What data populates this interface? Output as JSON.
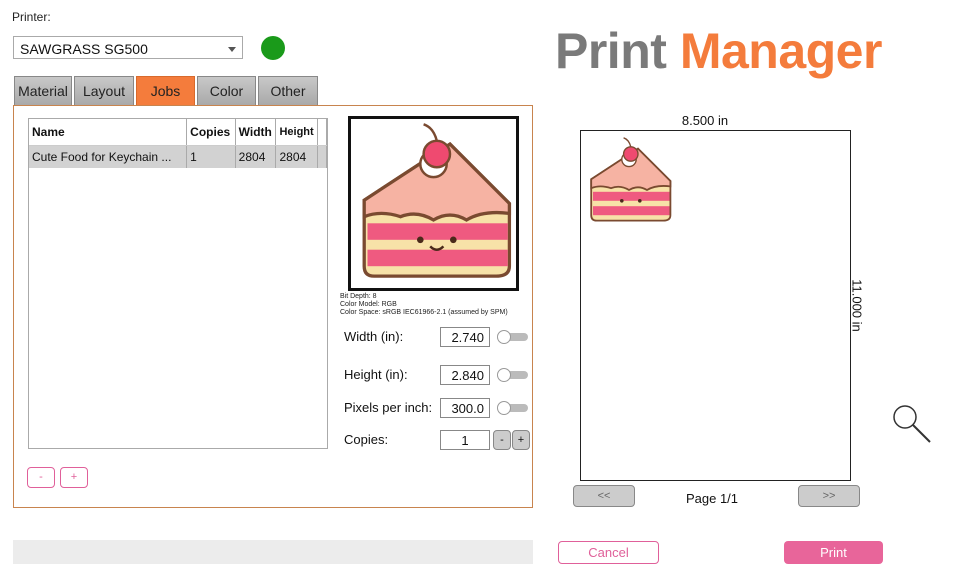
{
  "printer": {
    "label": "Printer:",
    "selected": "SAWGRASS SG500",
    "status_color": "#1a9a1a"
  },
  "tabs": [
    {
      "label": "Material"
    },
    {
      "label": "Layout"
    },
    {
      "label": "Jobs",
      "active": true
    },
    {
      "label": "Color"
    },
    {
      "label": "Other"
    }
  ],
  "jobs": {
    "columns": [
      "Name",
      "Copies",
      "Width",
      "Height"
    ],
    "rows": [
      {
        "name": "Cute Food for Keychain ...",
        "copies": "1",
        "width": "2804",
        "height": "2804"
      }
    ],
    "remove_label": "-",
    "add_label": "+"
  },
  "image_info": {
    "bit_depth": "Bit Depth: 8",
    "color_model": "Color Model: RGB",
    "color_space": "Color Space: sRGB IEC61966-2.1 (assumed by SPM)"
  },
  "fields": {
    "width_label": "Width (in):",
    "width": "2.740",
    "height_label": "Height (in):",
    "height": "2.840",
    "ppi_label": "Pixels per inch:",
    "ppi": "300.0",
    "copies_label": "Copies:",
    "copies": "1",
    "minus": "-",
    "plus": "+"
  },
  "brand": {
    "word1": "Print",
    "word2": "Manager",
    "color1": "#7a7a7a",
    "color2": "#f47c3c"
  },
  "preview": {
    "width_label": "8.500 in",
    "height_label": "11.000 in",
    "prev": "<<",
    "next": ">>",
    "page": "Page 1/1"
  },
  "actions": {
    "cancel": "Cancel",
    "print": "Print",
    "accent": "#e8659a"
  }
}
